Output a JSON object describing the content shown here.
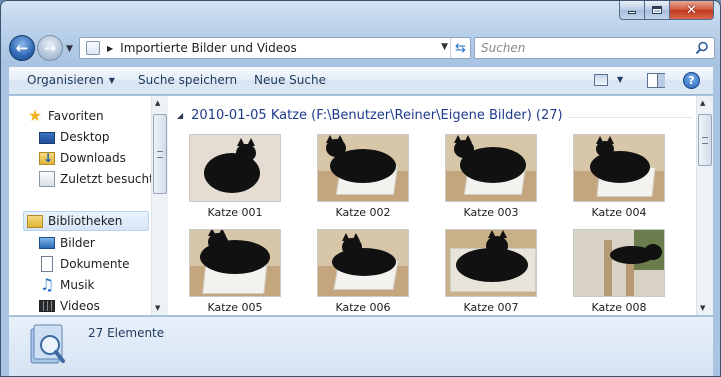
{
  "navbar": {
    "address_path": "Importierte Bilder und Videos",
    "search_placeholder": "Suchen"
  },
  "toolbar": {
    "organize_label": "Organisieren",
    "save_search_label": "Suche speichern",
    "new_search_label": "Neue Suche",
    "help_label": "?"
  },
  "sidebar": {
    "favorites_label": "Favoriten",
    "favorites": [
      {
        "label": "Desktop",
        "icon": "desktop-icon"
      },
      {
        "label": "Downloads",
        "icon": "downloads-icon"
      },
      {
        "label": "Zuletzt besucht",
        "icon": "recent-places-icon"
      }
    ],
    "libraries_label": "Bibliotheken",
    "libraries": [
      {
        "label": "Bilder",
        "icon": "pictures-icon"
      },
      {
        "label": "Dokumente",
        "icon": "documents-icon"
      },
      {
        "label": "Musik",
        "icon": "music-icon"
      },
      {
        "label": "Videos",
        "icon": "videos-icon"
      }
    ]
  },
  "content": {
    "group_header": "2010-01-05 Katze (F:\\Benutzer\\Reiner\\Eigene Bilder) (27)",
    "items": [
      {
        "name": "Katze 001"
      },
      {
        "name": "Katze 002"
      },
      {
        "name": "Katze 003"
      },
      {
        "name": "Katze 004"
      },
      {
        "name": "Katze 005"
      },
      {
        "name": "Katze 006"
      },
      {
        "name": "Katze 007"
      },
      {
        "name": "Katze 008"
      }
    ]
  },
  "details": {
    "count_text": "27 Elemente"
  },
  "colors": {
    "group_header": "#1e3a8c",
    "command_text": "#1e395b",
    "selected_nav": "#d6e6f8",
    "close_button": "#c2381d"
  }
}
